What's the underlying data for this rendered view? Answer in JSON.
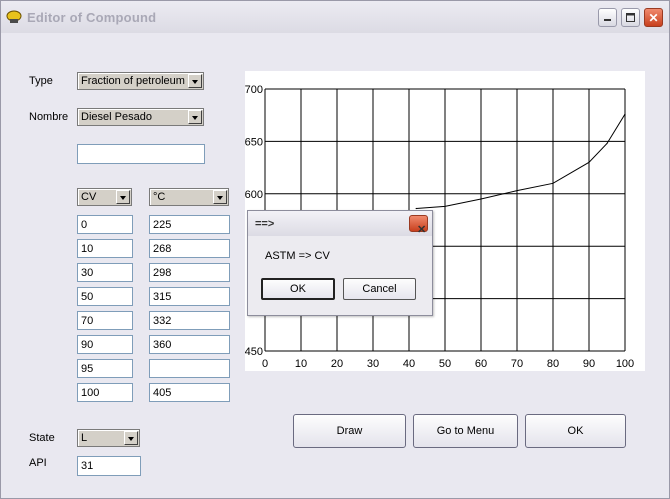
{
  "window": {
    "title": "Editor of Compound"
  },
  "form": {
    "type_label": "Type",
    "type_value": "Fraction of petroleum",
    "name_label": "Nombre",
    "name_value": "Diesel Pesado",
    "extra_value": "",
    "col1_unit": "CV",
    "col2_unit": "°C",
    "rows": [
      {
        "cv": "0",
        "t": "225"
      },
      {
        "cv": "10",
        "t": "268"
      },
      {
        "cv": "30",
        "t": "298"
      },
      {
        "cv": "50",
        "t": "315"
      },
      {
        "cv": "70",
        "t": "332"
      },
      {
        "cv": "90",
        "t": "360"
      },
      {
        "cv": "95",
        "t": ""
      },
      {
        "cv": "100",
        "t": "405"
      }
    ],
    "state_label": "State",
    "state_value": "L",
    "api_label": "API",
    "api_value": "31"
  },
  "buttons": {
    "draw": "Draw",
    "menu": "Go to Menu",
    "ok": "OK"
  },
  "dialog": {
    "title": "==>",
    "message": "ASTM => CV",
    "ok": "OK",
    "cancel": "Cancel"
  },
  "chart_data": {
    "type": "line",
    "xlim": [
      0,
      100
    ],
    "ylim": [
      450,
      700
    ],
    "xticks": [
      "0",
      "10",
      "20",
      "30",
      "40",
      "50",
      "60",
      "70",
      "80",
      "90",
      "100"
    ],
    "yticks": [
      "700",
      "650",
      "600",
      "",
      "450"
    ],
    "grid": true,
    "series": [
      {
        "x": [
          42,
          50,
          60,
          70,
          80,
          90,
          95,
          100
        ],
        "y": [
          586,
          588,
          595,
          603,
          610,
          630,
          648,
          676
        ]
      }
    ]
  }
}
